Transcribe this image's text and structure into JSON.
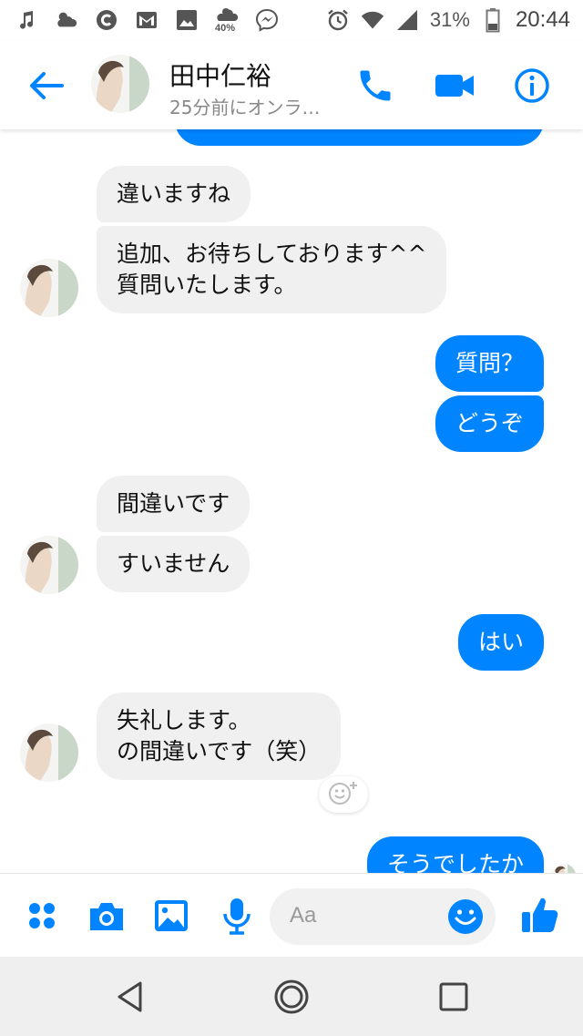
{
  "status_bar": {
    "battery_percent": "31%",
    "time": "20:44",
    "weather_badge": "40%",
    "icons": [
      "music-icon",
      "weather-icon",
      "c-app-icon",
      "gmail-icon",
      "gallery-icon",
      "weather-temp-icon",
      "messenger-icon",
      "alarm-icon",
      "wifi-icon",
      "signal-icon",
      "battery-icon"
    ]
  },
  "header": {
    "contact_name": "田中仁裕",
    "status": "25分前にオンラ…",
    "icons": [
      "back-arrow-icon",
      "phone-icon",
      "video-icon",
      "info-icon"
    ]
  },
  "messages": [
    {
      "dir": "in",
      "text": "違いますね"
    },
    {
      "dir": "in",
      "text": "追加、お待ちしております^^\n質問いたします。"
    },
    {
      "dir": "out",
      "text": "質問？"
    },
    {
      "dir": "out",
      "text": "どうぞ"
    },
    {
      "dir": "in",
      "text": "間違いです"
    },
    {
      "dir": "in",
      "text": "すいません"
    },
    {
      "dir": "out",
      "text": "はい"
    },
    {
      "dir": "in",
      "text": "失礼します。\nの間違いです（笑）"
    },
    {
      "dir": "out",
      "text": "そうでしたか"
    }
  ],
  "composer": {
    "placeholder": "Aa",
    "icons": [
      "apps-icon",
      "camera-icon",
      "image-icon",
      "microphone-icon",
      "emoji-icon",
      "thumbs-up-icon"
    ]
  },
  "colors": {
    "accent": "#0084ff",
    "incoming_bubble": "#f0f0f0",
    "outgoing_text": "#ffffff"
  },
  "navigation": {
    "icons": [
      "back-triangle-icon",
      "home-circle-icon",
      "recents-square-icon"
    ]
  }
}
